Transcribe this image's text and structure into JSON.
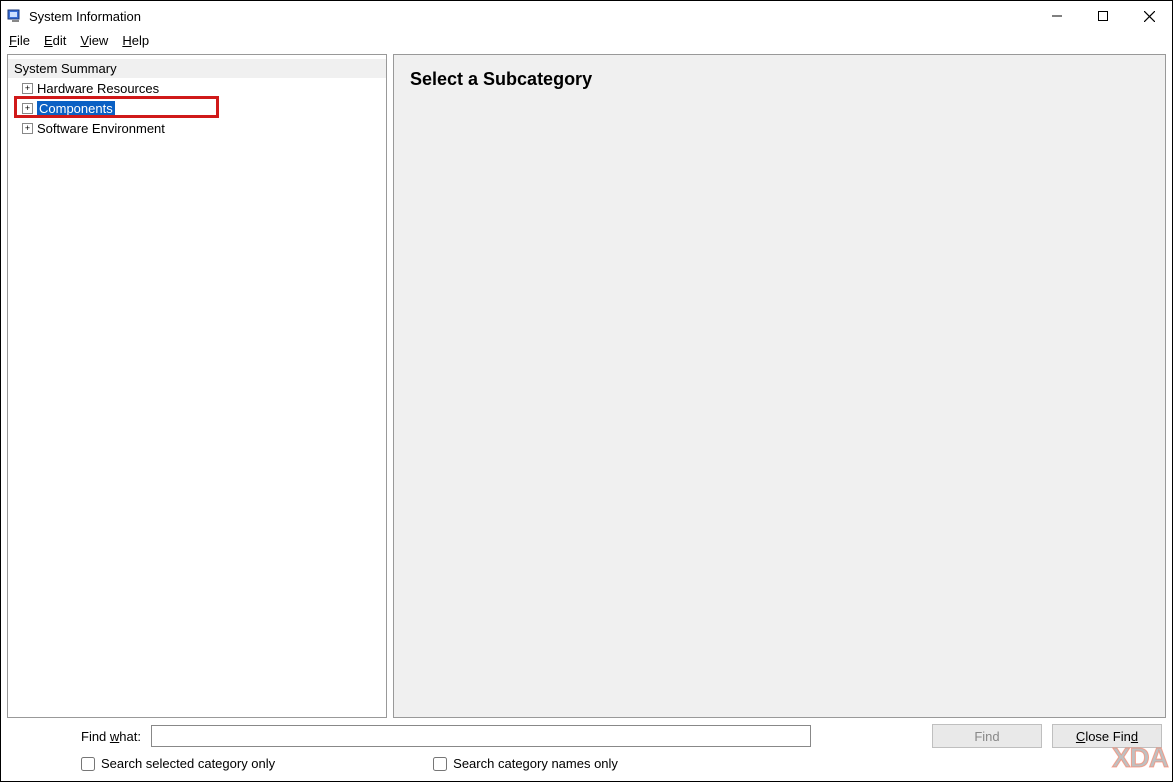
{
  "titlebar": {
    "title": "System Information"
  },
  "menu": {
    "file": "File",
    "edit": "Edit",
    "view": "View",
    "help": "Help"
  },
  "tree": {
    "root": "System Summary",
    "items": [
      {
        "label": "Hardware Resources"
      },
      {
        "label": "Components"
      },
      {
        "label": "Software Environment"
      }
    ]
  },
  "detail": {
    "heading": "Select a Subcategory"
  },
  "find": {
    "label": "Find what:",
    "value": "",
    "find_btn": "Find",
    "close_btn": "Close Find",
    "chk1": "Search selected category only",
    "chk2": "Search category names only"
  },
  "watermark": "XDA"
}
